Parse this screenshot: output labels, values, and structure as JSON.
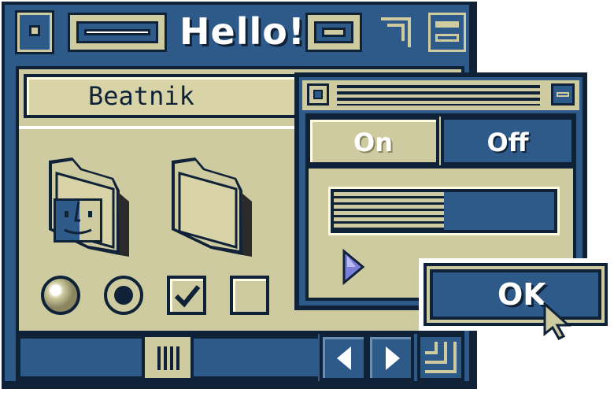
{
  "window": {
    "title": "Hello!",
    "name_field_value": "Beatnik"
  },
  "dialog": {
    "on_label": "On",
    "off_label": "Off",
    "progress": 0.5,
    "ok_label": "OK"
  },
  "controls": {
    "radio_1_selected": false,
    "radio_2_selected": true,
    "checkbox_1_checked": true,
    "checkbox_2_checked": false
  },
  "icons": {
    "close": "close-box-icon",
    "zoom": "zoom-box-icon",
    "collapse": "collapse-box-icon",
    "finder_folder": "finder-folder-icon",
    "folder": "folder-icon",
    "play": "play-triangle-icon",
    "cursor": "pointer-cursor-icon",
    "resize": "resize-grip-icon"
  },
  "colors": {
    "navy": "#0f2238",
    "blue": "#2e5a8a",
    "beige": "#cfcba0",
    "white": "#ffffff"
  }
}
